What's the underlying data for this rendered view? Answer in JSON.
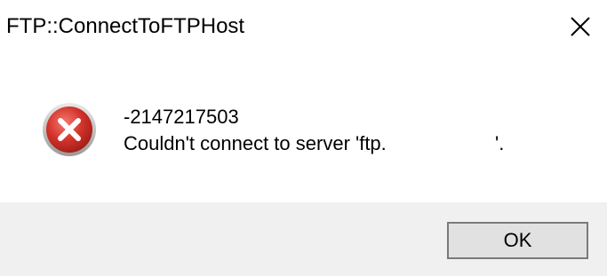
{
  "window": {
    "title": "FTP::ConnectToFTPHost",
    "close_icon": "close-icon"
  },
  "message": {
    "icon": "error-icon",
    "code": "-2147217503",
    "text": "Couldn't connect to server 'ftp.                    '."
  },
  "buttons": {
    "ok_label": "OK"
  },
  "colors": {
    "footer_bg": "#f0f0f0",
    "button_bg": "#e1e1e1",
    "button_border": "#7a7a7a",
    "error_red": "#c42b2b"
  }
}
